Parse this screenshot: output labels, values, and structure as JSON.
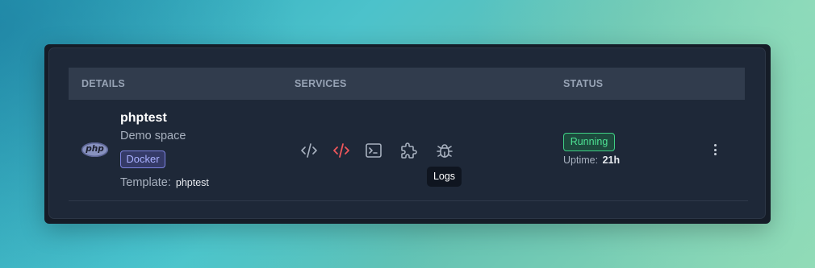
{
  "table": {
    "headers": {
      "details": "DETAILS",
      "services": "SERVICES",
      "status": "STATUS"
    }
  },
  "row": {
    "logo_text": "php",
    "name": "phptest",
    "description": "Demo space",
    "badge": "Docker",
    "template_label": "Template:",
    "template_value": "phptest",
    "services": [
      {
        "icon": "code-icon",
        "color": "#a8b1bf"
      },
      {
        "icon": "code-icon",
        "color": "#f0565b"
      },
      {
        "icon": "terminal-icon",
        "color": "#a8b1bf"
      },
      {
        "icon": "puzzle-icon",
        "color": "#a8b1bf"
      },
      {
        "icon": "bug-icon",
        "color": "#a8b1bf"
      }
    ],
    "tooltip": "Logs",
    "status": "Running",
    "uptime_label": "Uptime:",
    "uptime_value": "21h"
  },
  "colors": {
    "status_green": "#4ee394",
    "accent_red": "#f0565b",
    "badge_indigo": "#7c82df"
  }
}
